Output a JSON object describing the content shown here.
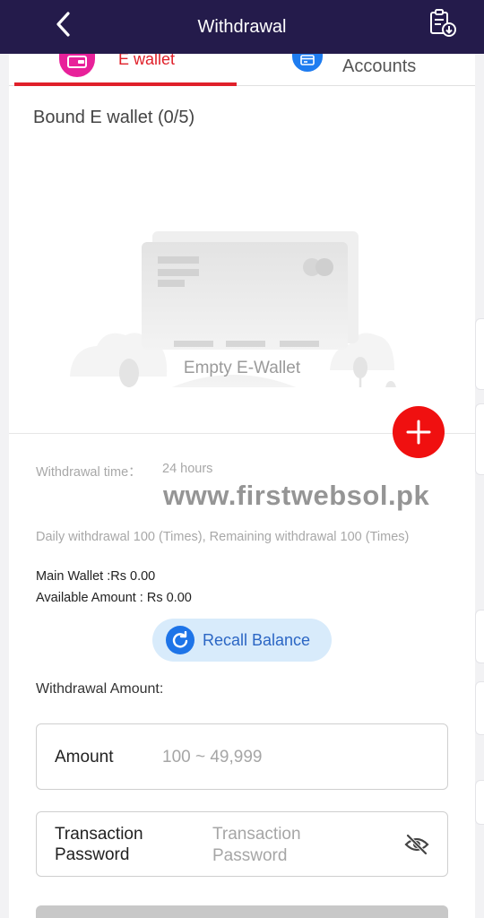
{
  "header": {
    "title": "Withdrawal",
    "back_icon": "chevron-left-icon",
    "record_icon": "clipboard-download-icon"
  },
  "tabs": [
    {
      "label": "E wallet",
      "icon": "wallet-icon",
      "active": true
    },
    {
      "label": "Accounts",
      "icon": "bank-card-icon",
      "active": false
    }
  ],
  "ewallet": {
    "bound_title": "Bound E wallet (0/5)",
    "empty_text": "Empty E-Wallet",
    "add_icon": "plus-icon"
  },
  "info": {
    "withdrawal_time_label": "Withdrawal time：",
    "withdrawal_time_value": "24 hours",
    "watermark": "www.firstwebsol.pk",
    "daily_limit": "Daily withdrawal 100 (Times), Remaining withdrawal 100 (Times)",
    "main_wallet": "Main Wallet :Rs 0.00",
    "available_amount": "Available Amount : Rs 0.00"
  },
  "recall": {
    "label": "Recall Balance",
    "icon": "refresh-icon"
  },
  "withdraw_form": {
    "amount_title": "Withdrawal Amount:",
    "amount_label": "Amount",
    "amount_placeholder": "100 ~ 49,999",
    "password_label": "Transaction Password",
    "password_placeholder": "Transaction Password",
    "eye_icon": "eye-off-icon"
  },
  "colors": {
    "header_bg": "#241b4b",
    "accent_red": "#e0202a",
    "add_button": "#f01010",
    "tab_wallet_icon": "#e8219a",
    "tab_accounts_icon": "#1e7cf0",
    "recall_bg": "#d8ebfb",
    "recall_text": "#2b66c4"
  }
}
